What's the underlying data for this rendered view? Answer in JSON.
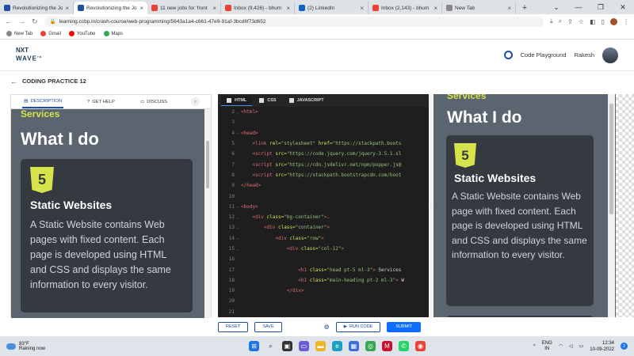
{
  "browser": {
    "tabs": [
      {
        "title": "Revolutionizing the Jo",
        "color": "#1e4fa3",
        "active": false
      },
      {
        "title": "Revolutionizing the Jo",
        "color": "#1e4fa3",
        "active": true
      },
      {
        "title": "11 new jobs for 'front",
        "color": "#ea4335",
        "active": false
      },
      {
        "title": "Inbox (9,426) - bhum",
        "color": "#ea4335",
        "active": false
      },
      {
        "title": "(2) LinkedIn",
        "color": "#0a66c2",
        "active": false
      },
      {
        "title": "Inbox (2,143) - bhum",
        "color": "#ea4335",
        "active": false
      },
      {
        "title": "New Tab",
        "color": "#888888",
        "active": false
      }
    ],
    "url": "learning.ccbp.in/crash-course/web-programming/5643a1a4-c661-47e9-91af-3bcd6f73d652",
    "bookmarks": [
      {
        "label": "New Tab",
        "color": "#888888"
      },
      {
        "label": "Gmail",
        "color": "#ea4335"
      },
      {
        "label": "YouTube",
        "color": "#ff0000"
      },
      {
        "label": "Maps",
        "color": "#34a853"
      }
    ]
  },
  "header": {
    "logo_top": "NXT",
    "logo_bottom": "WAVE",
    "logo_tm": "TM",
    "code_playground": "Code Playground",
    "user": "Rakesh"
  },
  "practice": {
    "back_arrow": "←",
    "title": "CODING PRACTICE 12"
  },
  "left_tabs": {
    "description": "DESCRIPTION",
    "get_help": "GET HELP",
    "discuss": "DISCUSS"
  },
  "section": {
    "services": "Services",
    "heading": "What I do",
    "card_badge": "5",
    "card_title": "Static Websites",
    "card_desc_left": [
      "A Static Website contains Web",
      "pages with fixed content. Each",
      "page is developed using HTML",
      "and CSS and displays the same",
      "information to every visitor."
    ],
    "card_desc_right": [
      "A Static Website contains Web",
      "page with fixed content. Each",
      "page is developed using HTML",
      "and CSS and displays the same",
      "information to every visitor."
    ]
  },
  "editor": {
    "tabs": [
      "HTML",
      "CSS",
      "JAVASCRIPT"
    ],
    "lines": [
      {
        "n": "2",
        "fold": "⌄",
        "parts": [
          [
            "tag",
            "<html>"
          ]
        ]
      },
      {
        "n": "3",
        "fold": "",
        "parts": []
      },
      {
        "n": "4",
        "fold": "⌄",
        "parts": [
          [
            "tag",
            "<head>"
          ]
        ]
      },
      {
        "n": "5",
        "fold": "",
        "parts": [
          [
            "txt",
            "    "
          ],
          [
            "tag",
            "<link "
          ],
          [
            "attr",
            "rel="
          ],
          [
            "str",
            "\"stylesheet\" "
          ],
          [
            "attr",
            "href="
          ],
          [
            "str",
            "\"https://stackpath.boots"
          ]
        ]
      },
      {
        "n": "6",
        "fold": "",
        "parts": [
          [
            "txt",
            "    "
          ],
          [
            "tag",
            "<script "
          ],
          [
            "attr",
            "src="
          ],
          [
            "str",
            "\"https://code.jquery.com/jquery-3.5.1.sl"
          ]
        ]
      },
      {
        "n": "7",
        "fold": "",
        "parts": [
          [
            "txt",
            "    "
          ],
          [
            "tag",
            "<script "
          ],
          [
            "attr",
            "src="
          ],
          [
            "str",
            "\"https://cdn.jsdelivr.net/npm/popper.js@"
          ]
        ]
      },
      {
        "n": "8",
        "fold": "",
        "parts": [
          [
            "txt",
            "    "
          ],
          [
            "tag",
            "<script "
          ],
          [
            "attr",
            "src="
          ],
          [
            "str",
            "\"https://stackpath.bootstrapcdn.com/boot"
          ]
        ]
      },
      {
        "n": "9",
        "fold": "",
        "parts": [
          [
            "tag",
            "</head>"
          ]
        ]
      },
      {
        "n": "10",
        "fold": "",
        "parts": []
      },
      {
        "n": "11",
        "fold": "⌄",
        "parts": [
          [
            "tag",
            "<body>"
          ]
        ]
      },
      {
        "n": "12",
        "fold": "⌄",
        "parts": [
          [
            "txt",
            "    "
          ],
          [
            "tag",
            "<div "
          ],
          [
            "attr",
            "class="
          ],
          [
            "str",
            "\"bg-container\""
          ],
          [
            "tag",
            ">"
          ],
          [
            "txt",
            "."
          ]
        ]
      },
      {
        "n": "13",
        "fold": "⌄",
        "parts": [
          [
            "txt",
            "        "
          ],
          [
            "tag",
            "<div "
          ],
          [
            "attr",
            "class="
          ],
          [
            "str",
            "\"container\""
          ],
          [
            "tag",
            ">"
          ]
        ]
      },
      {
        "n": "14",
        "fold": "⌄",
        "parts": [
          [
            "txt",
            "            "
          ],
          [
            "tag",
            "<div "
          ],
          [
            "attr",
            "class="
          ],
          [
            "str",
            "\"row\""
          ],
          [
            "tag",
            ">"
          ]
        ]
      },
      {
        "n": "15",
        "fold": "⌄",
        "parts": [
          [
            "txt",
            "                "
          ],
          [
            "tag",
            "<div "
          ],
          [
            "attr",
            "class="
          ],
          [
            "str",
            "\"col-12\""
          ],
          [
            "tag",
            ">"
          ]
        ]
      },
      {
        "n": "16",
        "fold": "",
        "parts": []
      },
      {
        "n": "17",
        "fold": "",
        "parts": [
          [
            "txt",
            "                    "
          ],
          [
            "tag",
            "<h1 "
          ],
          [
            "attr",
            "class="
          ],
          [
            "str",
            "\"head pt-5 ml-3\""
          ],
          [
            "tag",
            ">"
          ],
          [
            "txt",
            " Services"
          ]
        ]
      },
      {
        "n": "18",
        "fold": "",
        "parts": [
          [
            "txt",
            "                    "
          ],
          [
            "tag",
            "<h1 "
          ],
          [
            "attr",
            "class="
          ],
          [
            "str",
            "\"main-heading pt-2 ml-3\""
          ],
          [
            "tag",
            ">"
          ],
          [
            "txt",
            " W"
          ]
        ]
      },
      {
        "n": "19",
        "fold": "",
        "parts": [
          [
            "txt",
            "                "
          ],
          [
            "tag",
            "</div>"
          ]
        ]
      },
      {
        "n": "20",
        "fold": "",
        "parts": []
      },
      {
        "n": "21",
        "fold": "",
        "parts": []
      },
      {
        "n": "22",
        "fold": "⌄",
        "parts": [
          [
            "txt",
            "                "
          ],
          [
            "tag",
            "<div "
          ],
          [
            "attr",
            "class="
          ],
          [
            "str",
            "\"col-12 col-md-6 col-lg-4\""
          ],
          [
            "tag",
            ">"
          ]
        ]
      }
    ]
  },
  "actions": {
    "reset": "RESET",
    "save": "SAVE",
    "run_code": "RUN CODE",
    "submit": "SUBMIT"
  },
  "taskbar": {
    "temp": "83°F",
    "weather": "Raining now",
    "lang_top": "ENG",
    "lang_bottom": "IN",
    "time": "12:34",
    "date": "10-09-2022",
    "notif": "2"
  },
  "colors": {
    "accent_yellow": "#d7e34a",
    "card_bg": "#343a40",
    "section_bg": "#5b6570",
    "primary_blue": "#0d6efd"
  }
}
